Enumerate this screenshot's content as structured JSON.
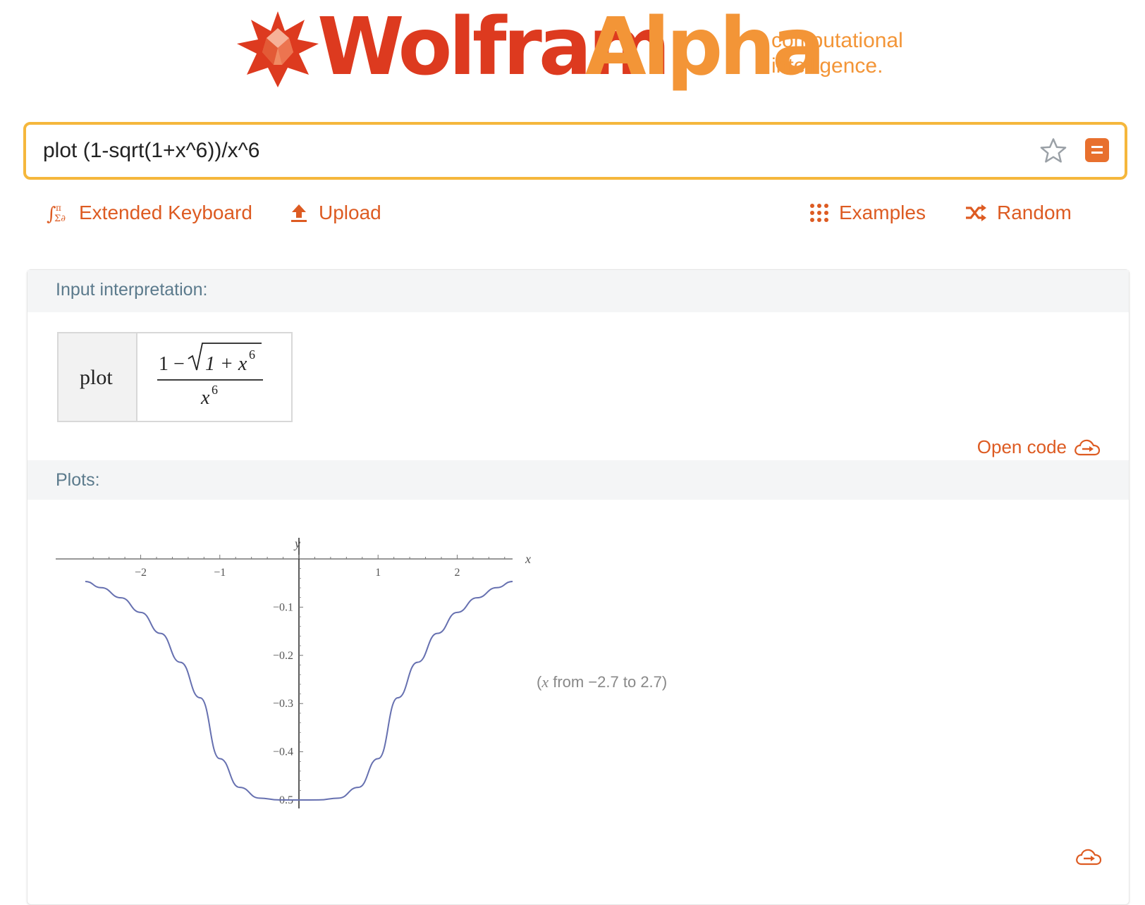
{
  "brand": {
    "wolfram": "Wolfram",
    "alpha": "Alpha",
    "tagline_line1": "computational",
    "tagline_line2": "intelligence.",
    "colors": {
      "red": "#dd3a1f",
      "orange": "#f39537",
      "link": "#dd5b22"
    }
  },
  "search": {
    "query": "plot (1-sqrt(1+x^6))/x^6",
    "favorite_icon": "star-icon",
    "menu_icon": "menu-icon"
  },
  "toolbar": {
    "extended_keyboard": "Extended Keyboard",
    "upload": "Upload",
    "examples": "Examples",
    "random": "Random"
  },
  "pods": {
    "interpretation": {
      "title": "Input interpretation:",
      "plot_word": "plot",
      "numerator_prefix": "1 −",
      "radicand": "1 + x",
      "exponent": "6",
      "denominator": "x",
      "open_code": "Open code"
    },
    "plots": {
      "title": "Plots:",
      "note_var": "x",
      "note_text": " from −2.7 to 2.7)",
      "note_open": "("
    }
  },
  "chart_data": {
    "type": "line",
    "function": "(1 - sqrt(1 + x^6)) / x^6",
    "xlabel": "x",
    "ylabel": "y",
    "xlim": [
      -2.7,
      2.7
    ],
    "ylim": [
      -0.5,
      0.0
    ],
    "x_ticks": [
      {
        "label": "−2",
        "value": -2
      },
      {
        "label": "−1",
        "value": -1
      },
      {
        "label": "1",
        "value": 1
      },
      {
        "label": "2",
        "value": 2
      }
    ],
    "y_ticks": [
      {
        "label": "−0.1",
        "value": -0.1
      },
      {
        "label": "−0.2",
        "value": -0.2
      },
      {
        "label": "−0.3",
        "value": -0.3
      },
      {
        "label": "−0.4",
        "value": -0.4
      },
      {
        "label": "−0.5",
        "value": -0.5
      }
    ],
    "series": [
      {
        "color": "#6670b0",
        "x": [
          -2.7,
          -2.5,
          -2.25,
          -2.0,
          -1.75,
          -1.5,
          -1.25,
          -1.0,
          -0.75,
          -0.5,
          -0.25,
          0.0,
          0.25,
          0.5,
          0.75,
          1.0,
          1.25,
          1.5,
          1.75,
          2.0,
          2.25,
          2.5,
          2.7
        ],
        "y": [
          -0.0467,
          -0.0596,
          -0.0806,
          -0.111,
          -0.1545,
          -0.2143,
          -0.288,
          -0.4142,
          -0.4738,
          -0.4961,
          -0.4999,
          -0.5,
          -0.4999,
          -0.4961,
          -0.4738,
          -0.4142,
          -0.288,
          -0.2143,
          -0.1545,
          -0.111,
          -0.0806,
          -0.0596,
          -0.0467
        ]
      }
    ]
  }
}
